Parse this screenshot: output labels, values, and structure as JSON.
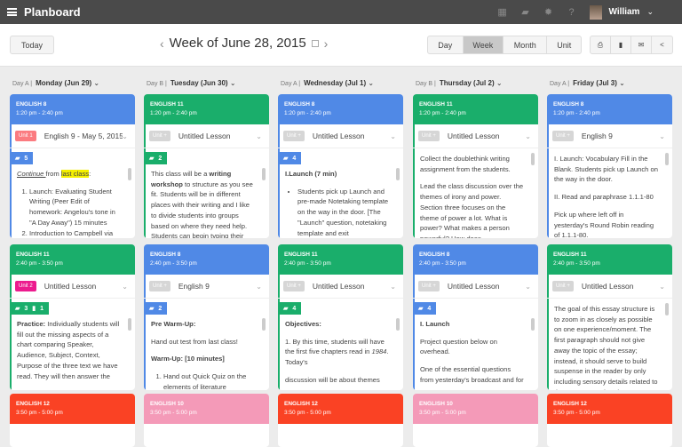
{
  "app": {
    "title": "Planboard",
    "user": "William",
    "icons": [
      "calendar-icon",
      "book-icon",
      "gear-icon",
      "help-icon"
    ]
  },
  "toolbar": {
    "today": "Today",
    "week_title": "Week of June 28, 2015",
    "prev": "‹",
    "next": "›",
    "views": [
      "Day",
      "Week",
      "Month",
      "Unit"
    ],
    "active_view": "Week",
    "actions": [
      "print-icon",
      "file-icon",
      "email-icon",
      "share-icon"
    ]
  },
  "colors": {
    "blue": "#5089e6",
    "green": "#1aae6b",
    "red": "#fa4224",
    "pink": "#f49ab8",
    "unit1": "#fb7b80",
    "unit2": "#ec1b8e",
    "unitplus": "#d6d6d6"
  },
  "days": [
    {
      "daytype": "Day A",
      "label": "Monday (Jun 29)"
    },
    {
      "daytype": "Day B",
      "label": "Tuesday (Jun 30)"
    },
    {
      "daytype": "Day A",
      "label": "Wednesday (Jul 1)"
    },
    {
      "daytype": "Day B",
      "label": "Thursday (Jul 2)"
    },
    {
      "daytype": "Day A",
      "label": "Friday (Jul 3)"
    }
  ],
  "rows": [
    [
      {
        "course": "ENGLISH 8",
        "time": "1:20 pm - 2:40 pm",
        "color": "blue",
        "unit": "Unit 1",
        "unit_color": "unit1",
        "lesson": "English 9 - May 5, 2015",
        "badges": [
          "5"
        ],
        "content": [
          {
            "t": "p",
            "runs": [
              {
                "s": "Continue ",
                "i": 1,
                "u": 1
              },
              {
                "s": "from "
              },
              {
                "s": "last class",
                "hl": 1
              },
              {
                "s": ":"
              }
            ]
          },
          {
            "t": "ol",
            "items": [
              "Launch: Evaluating Student Writing (Peer Edit of homework: Angelou's tone in \"A Day Away\") 15 minutes",
              "Introduction to Campbell via"
            ]
          }
        ]
      },
      {
        "course": "ENGLISH 11",
        "time": "1:20 pm - 2:40 pm",
        "color": "green",
        "unit": "Unit +",
        "unit_color": "unitplus",
        "lesson": "Untitled Lesson",
        "badges": [
          "2"
        ],
        "content": [
          {
            "t": "p",
            "runs": [
              {
                "s": "This class will be a "
              },
              {
                "s": "writing workshop",
                "b": 1
              },
              {
                "s": " to structure as you see fit. Students will be in different places with their writing and I like to divide students into groups based on where they need help. Students can begin typing their"
              }
            ]
          }
        ]
      },
      {
        "course": "ENGLISH 8",
        "time": "1:20 pm - 2:40 pm",
        "color": "blue",
        "unit": "Unit +",
        "unit_color": "unitplus",
        "lesson": "Untitled Lesson",
        "badges": [
          "4"
        ],
        "content": [
          {
            "t": "p",
            "runs": [
              {
                "s": "I.Launch (7 min)",
                "b": 1
              }
            ]
          },
          {
            "t": "ul",
            "items": [
              "Students pick up Launch and pre-made Notetaking template on the way in the door. [The \"Launch\" question, notetaking template and exit"
            ]
          }
        ]
      },
      {
        "course": "ENGLISH 11",
        "time": "1:20 pm - 2:40 pm",
        "color": "green",
        "unit": "Unit +",
        "unit_color": "unitplus",
        "lesson": "Untitled Lesson",
        "badges": [],
        "content": [
          {
            "t": "p",
            "runs": [
              {
                "s": "Collect the doublethink writing assignment from the students."
              }
            ]
          },
          {
            "t": "p",
            "runs": [
              {
                "s": "Lead the class discussion over the themes of irony and power. Section three focuses on the theme of power a lot. What is power? What makes a person powerful? How does"
              }
            ]
          }
        ]
      },
      {
        "course": "ENGLISH 8",
        "time": "1:20 pm - 2:40 pm",
        "color": "blue",
        "unit": "Unit +",
        "unit_color": "unitplus",
        "lesson": "English 9",
        "badges": [],
        "content": [
          {
            "t": "p",
            "runs": [
              {
                "s": "I. Launch: Vocabulary Fill in the Blank. Students pick up Launch on the way in the door."
              }
            ]
          },
          {
            "t": "p",
            "runs": [
              {
                "s": "II. Read and paraphrase 1.1.1-80"
              }
            ]
          },
          {
            "t": "p",
            "runs": [
              {
                "s": "Pick up where left off in yesterday's Round Robin reading of 1.1.1-80."
              }
            ]
          }
        ]
      }
    ],
    [
      {
        "course": "ENGLISH 11",
        "time": "2:40 pm - 3:50 pm",
        "color": "green",
        "unit": "Unit 2",
        "unit_color": "unit2",
        "lesson": "Untitled Lesson",
        "badges": [
          "3",
          "1"
        ],
        "content": [
          {
            "t": "p",
            "runs": [
              {
                "s": "Practice:",
                "b": 1
              },
              {
                "s": " Individually students will fill out the missing aspects of a chart comparing Speaker, Audience, Subject, Context, Purpose of the three text we have read. They will then answer the"
              }
            ]
          }
        ]
      },
      {
        "course": "ENGLISH 8",
        "time": "2:40 pm - 3:50 pm",
        "color": "blue",
        "unit": "Unit +",
        "unit_color": "unitplus",
        "lesson": "English 9",
        "badges": [
          "2"
        ],
        "content": [
          {
            "t": "p",
            "runs": [
              {
                "s": "Pre Warm-Up:",
                "b": 1
              }
            ]
          },
          {
            "t": "p",
            "runs": [
              {
                "s": "Hand out test from last class!"
              }
            ]
          },
          {
            "t": "p",
            "runs": [
              {
                "s": "Warm-Up: [10 minutes]",
                "b": 1
              }
            ]
          },
          {
            "t": "ol",
            "items": [
              "Hand out Quick Quiz on the elements of literature"
            ]
          }
        ]
      },
      {
        "course": "ENGLISH 11",
        "time": "2:40 pm - 3:50 pm",
        "color": "green",
        "unit": "Unit +",
        "unit_color": "unitplus",
        "lesson": "Untitled Lesson",
        "badges": [
          "4"
        ],
        "content": [
          {
            "t": "p",
            "runs": [
              {
                "s": "Objectives:",
                "b": 1
              }
            ]
          },
          {
            "t": "p",
            "runs": [
              {
                "s": "1. By this time, students will have the first five chapters read in "
              },
              {
                "s": "1984",
                "i": 1
              },
              {
                "s": ". Today's"
              }
            ]
          },
          {
            "t": "p",
            "runs": [
              {
                "s": "discussion will be about themes"
              }
            ]
          }
        ]
      },
      {
        "course": "ENGLISH 8",
        "time": "2:40 pm - 3:50 pm",
        "color": "blue",
        "unit": "Unit +",
        "unit_color": "unitplus",
        "lesson": "Untitled Lesson",
        "badges": [
          "4"
        ],
        "content": [
          {
            "t": "p",
            "runs": [
              {
                "s": "I. Launch",
                "b": 1
              }
            ]
          },
          {
            "t": "p",
            "runs": [
              {
                "s": "Project question below on overhead."
              }
            ]
          },
          {
            "t": "p",
            "runs": [
              {
                "s": "One of the essential questions from yesterday's broadcast and for"
              }
            ]
          }
        ]
      },
      {
        "course": "ENGLISH 11",
        "time": "2:40 pm - 3:50 pm",
        "color": "green",
        "unit": "Unit +",
        "unit_color": "unitplus",
        "lesson": "Untitled Lesson",
        "badges": [],
        "content": [
          {
            "t": "p",
            "runs": [
              {
                "s": "The goal of this essay structure is to zoom in as closely as possible on one experience/moment. The first paragraph should not give away the topic of the essay; instead, it should serve to build suspense in the reader by only including sensory details related to the moment. Rather than beginning"
              }
            ]
          }
        ]
      }
    ],
    [
      {
        "course": "ENGLISH 12",
        "time": "3:50 pm - 5:00 pm",
        "color": "red"
      },
      {
        "course": "ENGLISH 10",
        "time": "3:50 pm - 5:00 pm",
        "color": "pink"
      },
      {
        "course": "ENGLISH 12",
        "time": "3:50 pm - 5:00 pm",
        "color": "red"
      },
      {
        "course": "ENGLISH 10",
        "time": "3:50 pm - 5:00 pm",
        "color": "pink"
      },
      {
        "course": "ENGLISH 12",
        "time": "3:50 pm - 5:00 pm",
        "color": "red"
      }
    ]
  ]
}
